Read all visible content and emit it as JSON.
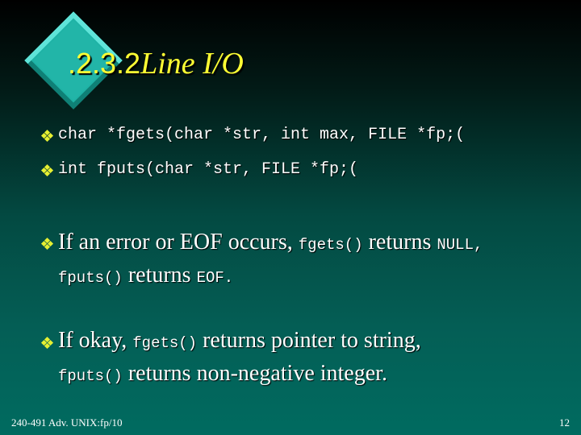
{
  "slide": {
    "title_number": ".2.3.2",
    "title_text": "Line I/O",
    "bullets": [
      {
        "code": "char *fgets(char *str, int max, FILE *fp;("
      },
      {
        "code": "int fputs(char *str, FILE *fp;("
      },
      {
        "line1": {
          "t1": "If an error or EOF occurs, ",
          "c1": "fgets()",
          "t2": " returns ",
          "c2": "NULL,"
        },
        "line2": {
          "c1": "fputs()",
          "t1": " returns ",
          "c2": "EOF."
        }
      },
      {
        "line1": {
          "t1": "If okay, ",
          "c1": "fgets()",
          "t2": " returns pointer to string,"
        },
        "line2": {
          "c1": "fputs()",
          "t1": " returns non-negative integer."
        }
      }
    ],
    "footer": {
      "left": "240-491 Adv. UNIX:fp/10",
      "page_number": "12"
    },
    "colors": {
      "title": "#ffff33",
      "bullet": "#e6f032",
      "diamond": "#1fb3a6",
      "background_top": "#000000",
      "background_bottom": "#006b60"
    }
  }
}
